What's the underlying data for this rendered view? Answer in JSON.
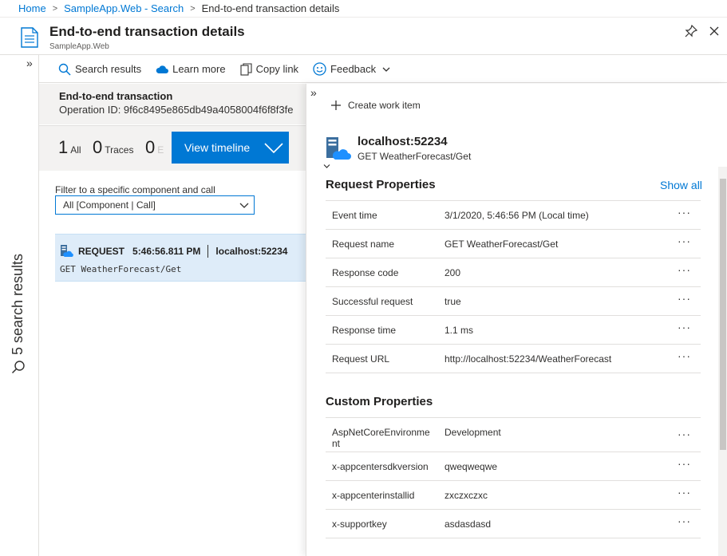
{
  "breadcrumb": {
    "items": [
      "Home",
      "SampleApp.Web - Search"
    ],
    "current": "End-to-end transaction details"
  },
  "header": {
    "title": "End-to-end transaction details",
    "subtitle": "SampleApp.Web"
  },
  "rail": {
    "expand": "»",
    "label": "5 search results"
  },
  "toolbar": {
    "search_results": "Search results",
    "learn_more": "Learn more",
    "copy_link": "Copy link",
    "feedback": "Feedback"
  },
  "summary": {
    "title": "End-to-end transaction",
    "operation_id": "Operation ID: 9f6c8495e865db49a4058004f6f8f3fe"
  },
  "counts": [
    {
      "number": "1",
      "label": "All"
    },
    {
      "number": "0",
      "label": "Traces"
    },
    {
      "number": "0",
      "label": "E"
    }
  ],
  "view_timeline_label": "View timeline",
  "filter": {
    "label": "Filter to a specific component and call",
    "value": "All [Component | Call]"
  },
  "request": {
    "type": "REQUEST",
    "time": "5:46:56.811 PM",
    "host": "localhost:52234",
    "operation": "GET WeatherForecast/Get"
  },
  "details": {
    "collapse": "»",
    "create_work_item": "Create work item",
    "title": "localhost:52234",
    "subtitle": "GET WeatherForecast/Get",
    "request_properties_title": "Request Properties",
    "show_all": "Show all",
    "request_properties": [
      {
        "key": "Event time",
        "value": "3/1/2020, 5:46:56 PM (Local time)"
      },
      {
        "key": "Request name",
        "value": "GET WeatherForecast/Get"
      },
      {
        "key": "Response code",
        "value": "200"
      },
      {
        "key": "Successful request",
        "value": "true"
      },
      {
        "key": "Response time",
        "value": "1.1 ms"
      },
      {
        "key": "Request URL",
        "value": "http://localhost:52234/WeatherForecast"
      }
    ],
    "custom_properties_title": "Custom Properties",
    "custom_properties": [
      {
        "key": "AspNetCoreEnvironme nt",
        "value": "Development"
      },
      {
        "key": "x-appcentersdkversion",
        "value": "qweqweqwe"
      },
      {
        "key": "x-appcenterinstallid",
        "value": "zxczxczxc"
      },
      {
        "key": "x-supportkey",
        "value": "asdasdasd"
      }
    ],
    "more_label": "···"
  },
  "colors": {
    "accent": "#0078d4",
    "selected_row": "#deecf9",
    "summary_bg": "#f3f2f1"
  },
  "icons": [
    "document-icon",
    "pin-icon",
    "close-icon",
    "search-icon",
    "cloud-icon",
    "copy-icon",
    "smiley-icon",
    "chevron-down-icon",
    "plus-icon",
    "server-icon",
    "more-icon"
  ]
}
